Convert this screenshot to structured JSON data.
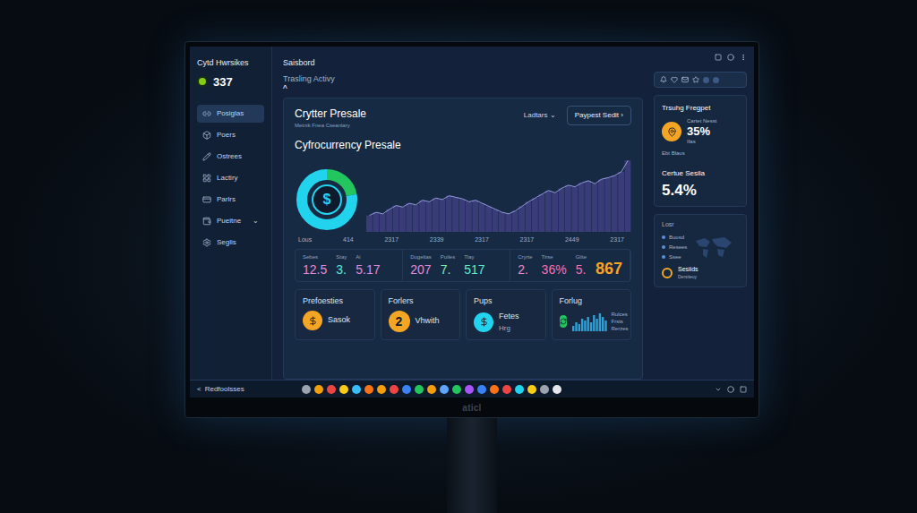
{
  "sidebar": {
    "title": "Cytd Hwrsikes",
    "count": "337",
    "items": [
      {
        "label": "Posiglas",
        "selected": true
      },
      {
        "label": "Poers",
        "selected": false
      },
      {
        "label": "Ostrees",
        "selected": false
      },
      {
        "label": "Lactiry",
        "selected": false
      },
      {
        "label": "Parlrs",
        "selected": false
      },
      {
        "label": "Pueitne",
        "selected": false,
        "caret": "⌄"
      },
      {
        "label": "Seglis",
        "selected": false
      }
    ]
  },
  "topbar": {
    "title": "Saisbord",
    "subtitle": "Trasling Activy",
    "caret": "^"
  },
  "header": {
    "title": "Crytter Presale",
    "subtitle": "Metnik Fnea Cseanlary",
    "dropdown": "Ladtars",
    "dropdown_caret": "⌄",
    "button": "Paypest Sedit",
    "button_arrow": "›"
  },
  "chart": {
    "title": "Cyfrocurrency Presale",
    "coin": "$",
    "donut_values": [
      22,
      78
    ],
    "values": [
      22,
      26,
      24,
      30,
      35,
      33,
      38,
      36,
      42,
      40,
      45,
      43,
      48,
      46,
      44,
      40,
      42,
      38,
      34,
      30,
      26,
      24,
      28,
      34,
      40,
      45,
      50,
      55,
      52,
      58,
      62,
      60,
      65,
      68,
      64,
      70,
      72,
      75,
      80,
      95
    ],
    "x_ticks": [
      "Lous",
      "414",
      "2317",
      "2339",
      "2317",
      "2317",
      "2449",
      "2317"
    ]
  },
  "stats": [
    {
      "items": [
        {
          "label": "Sebes",
          "value": "12.5",
          "color": "#e48ad8"
        },
        {
          "label": "Stay",
          "value": "3.",
          "color": "#5eead4"
        },
        {
          "label": "Ai",
          "value": "5.17",
          "color": "#e48ad8"
        }
      ]
    },
    {
      "items": [
        {
          "label": "Dugeltas",
          "value": "207",
          "color": "#e48ad8"
        },
        {
          "label": "Puiles",
          "value": "7.",
          "color": "#86efac"
        },
        {
          "label": "Tlay",
          "value": "517",
          "color": "#5eead4"
        }
      ]
    },
    {
      "items": [
        {
          "label": "Cryrte",
          "value": "2.",
          "color": "#e48ad8"
        },
        {
          "label": "Tirse",
          "value": "36%",
          "color": "#f472b6"
        },
        {
          "label": "Glite",
          "value": "5.",
          "color": "#f472b6"
        }
      ],
      "highlight": "867",
      "highlight_color": "#f5a524"
    }
  ],
  "cards": [
    {
      "title": "Prefoesties",
      "kind": "icon",
      "color": "#f5a524",
      "text": "Sasok"
    },
    {
      "title": "Forlers",
      "kind": "number",
      "color": "#f5a524",
      "number": "2",
      "text": "Vhwith"
    },
    {
      "title": "Pups",
      "kind": "icon",
      "color": "#22d3ee",
      "text": "Fetes",
      "subtext": "Hrg"
    },
    {
      "title": "Forlug",
      "kind": "chart",
      "color": "#22c55e",
      "values": [
        3,
        5,
        4,
        7,
        6,
        8,
        5,
        9,
        7,
        10,
        8,
        6
      ],
      "legend": [
        "Rulces",
        "Frsts",
        "Rerzes"
      ]
    }
  ],
  "right_panel": {
    "title": "Trsuhg Fregpet",
    "metric_label": "Cartet Nesst",
    "metric_value": "35%",
    "metric_note": "Ifas",
    "footnote": "Ebt Blaus",
    "second_label": "Certue Sesila",
    "second_value": "5.4%",
    "map_title": "Losr",
    "legend": [
      {
        "label": "Buosd",
        "color": "#5b8fd6"
      },
      {
        "label": "Resees",
        "color": "#5b8fd6"
      },
      {
        "label": "Ssee",
        "color": "#5b8fd6"
      }
    ],
    "item": {
      "title": "Sesiids",
      "subtitle": "Dersiteuy",
      "color": "#f5a524"
    }
  },
  "taskbar": {
    "back": "<",
    "label": "Redfoolsses"
  },
  "monitor": {
    "brand": "aticl"
  }
}
